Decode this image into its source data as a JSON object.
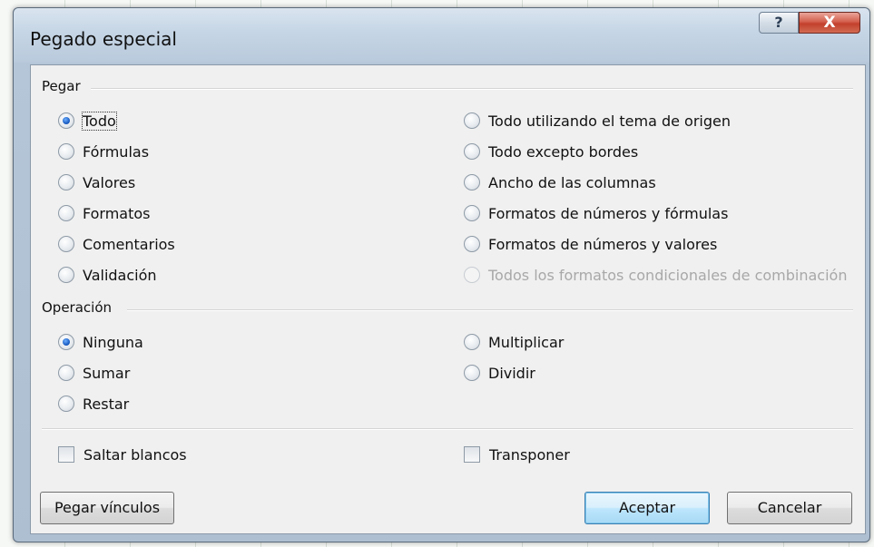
{
  "window": {
    "title": "Pegado especial",
    "help_label": "?",
    "close_label": "X"
  },
  "pegar": {
    "label": "Pegar",
    "left_options": [
      {
        "label": "Todo",
        "checked": true
      },
      {
        "label": "Fórmulas",
        "checked": false
      },
      {
        "label": "Valores",
        "checked": false
      },
      {
        "label": "Formatos",
        "checked": false
      },
      {
        "label": "Comentarios",
        "checked": false
      },
      {
        "label": "Validación",
        "checked": false
      }
    ],
    "right_options": [
      {
        "label": "Todo utilizando el tema de origen",
        "checked": false,
        "disabled": false
      },
      {
        "label": "Todo excepto bordes",
        "checked": false,
        "disabled": false
      },
      {
        "label": "Ancho de las columnas",
        "checked": false,
        "disabled": false
      },
      {
        "label": "Formatos de números y fórmulas",
        "checked": false,
        "disabled": false
      },
      {
        "label": "Formatos de números y valores",
        "checked": false,
        "disabled": false
      },
      {
        "label": "Todos los formatos condicionales de combinación",
        "checked": false,
        "disabled": true
      }
    ]
  },
  "operacion": {
    "label": "Operación",
    "left_options": [
      {
        "label": "Ninguna",
        "checked": true
      },
      {
        "label": "Sumar",
        "checked": false
      },
      {
        "label": "Restar",
        "checked": false
      }
    ],
    "right_options": [
      {
        "label": "Multiplicar",
        "checked": false
      },
      {
        "label": "Dividir",
        "checked": false
      }
    ]
  },
  "checkboxes": {
    "skip_blanks": {
      "label": "Saltar blancos",
      "checked": false
    },
    "transpose": {
      "label": "Transponer",
      "checked": false
    }
  },
  "buttons": {
    "paste_links": "Pegar vínculos",
    "ok": "Aceptar",
    "cancel": "Cancelar"
  },
  "colors": {
    "titlebar": "#c5d5e5",
    "close_button": "#c2402d",
    "radio_selected": "#1c5fc5",
    "default_button_border": "#3c7fb1"
  }
}
